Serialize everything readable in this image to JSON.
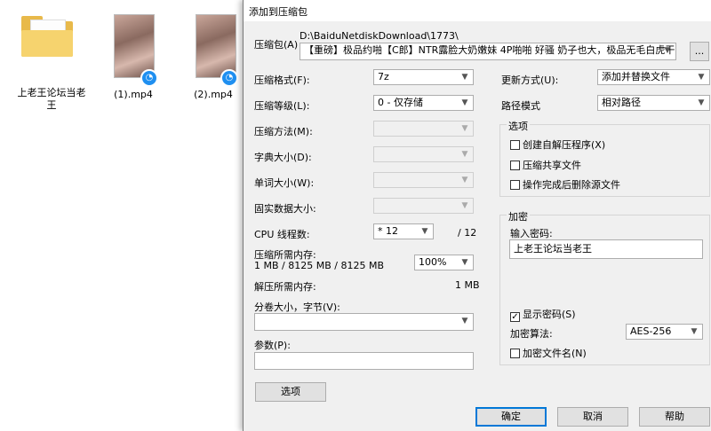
{
  "desktop": {
    "folder_label": "上老王论坛当老王",
    "video1_label": "(1).mp4",
    "video2_label": "(2).mp4"
  },
  "dialog": {
    "title": "添加到压缩包",
    "archive_label": "压缩包(A)",
    "archive_path": "D:\\BaiduNetdiskDownload\\1773\\",
    "archive_name": "【重磅】极品约啪【C郎】NTR露脸大奶嫩妹 4P啪啪 好骚 奶子也大，极品无毛白虎干的爽",
    "browse_label": "...",
    "format_label": "压缩格式(F):",
    "format_value": "7z",
    "level_label": "压缩等级(L):",
    "level_value": "0 - 仅存储",
    "method_label": "压缩方法(M):",
    "dict_label": "字典大小(D):",
    "word_label": "单词大小(W):",
    "solid_label": "固实数据大小:",
    "cpu_label": "CPU 线程数:",
    "cpu_value": "* 12",
    "cpu_total": "/ 12",
    "mem_label": "压缩所需内存:",
    "mem_values": "1 MB / 8125 MB / 8125 MB",
    "mem_percent": "100%",
    "decomp_label": "解压所需内存:",
    "decomp_value": "1 MB",
    "split_label": "分卷大小，字节(V):",
    "params_label": "参数(P):",
    "options_button": "选项",
    "update_label": "更新方式(U):",
    "update_value": "添加并替换文件",
    "path_label": "路径模式",
    "path_value": "相对路径",
    "options_group": "选项",
    "opt_sfx": "创建自解压程序(X)",
    "opt_shared": "压缩共享文件",
    "opt_delete": "操作完成后删除源文件",
    "encrypt_group": "加密",
    "password_label": "输入密码:",
    "password_value": "上老王论坛当老王",
    "show_password": "显示密码(S)",
    "algo_label": "加密算法:",
    "algo_value": "AES-256",
    "encrypt_names": "加密文件名(N)",
    "ok": "确定",
    "cancel": "取消",
    "help": "帮助"
  }
}
